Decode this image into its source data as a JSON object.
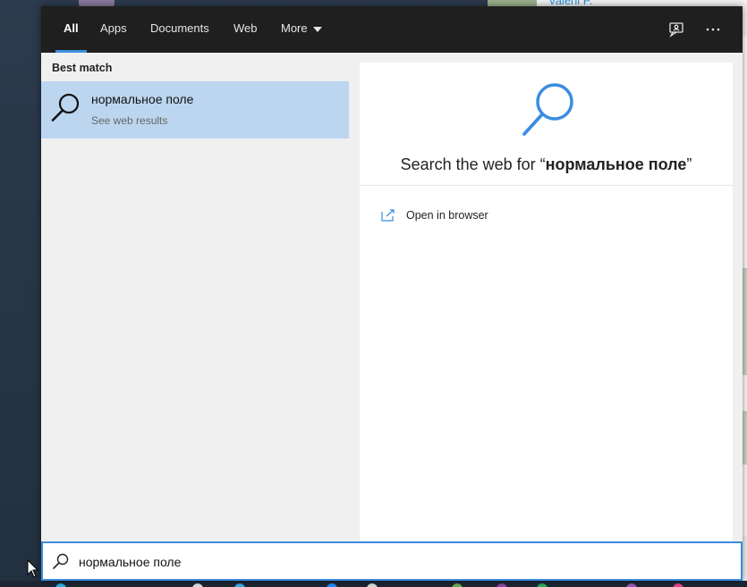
{
  "background": {
    "page_name": "Valerii P."
  },
  "tabs": [
    {
      "label": "All",
      "active": true
    },
    {
      "label": "Apps",
      "active": false
    },
    {
      "label": "Documents",
      "active": false
    },
    {
      "label": "Web",
      "active": false
    },
    {
      "label": "More",
      "active": false
    }
  ],
  "top_icons": {
    "feedback": "feedback-icon",
    "more_options": "ellipsis-icon"
  },
  "best_match": {
    "section_title": "Best match",
    "item_title": "нормальное поле",
    "item_subtitle": "See web results",
    "icon": "search-icon"
  },
  "preview": {
    "prefix": "Search the web for “",
    "query": "нормальное поле",
    "suffix": "”",
    "icon": "search-icon",
    "actions": [
      {
        "label": "Open in browser",
        "icon": "open-browser-icon"
      }
    ]
  },
  "search": {
    "value": "нормальное поле",
    "icon": "search-icon"
  },
  "colors": {
    "accent": "#3a8de0",
    "selection": "#bcd6f0",
    "topbar": "#1f1f1f"
  }
}
